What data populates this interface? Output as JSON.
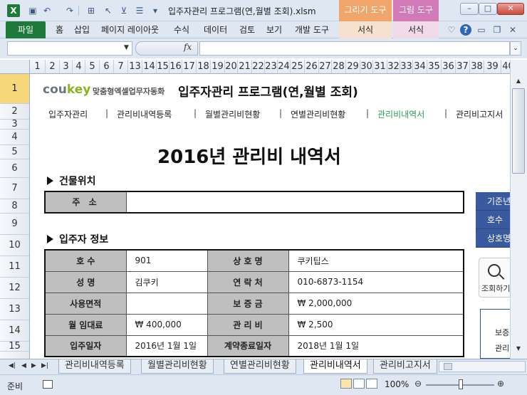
{
  "window": {
    "title": "입주자관리 프로그램(연,월별 조회).xlsm",
    "context_tabs": [
      "그리기 도구",
      "그림 도구"
    ],
    "buttons": {
      "minimize": "–",
      "maximize": "□",
      "close": "✕"
    }
  },
  "ribbon": {
    "file_tab": "파일",
    "tabs": [
      "홈",
      "삽입",
      "페이지 레이아웃",
      "수식",
      "데이터",
      "검토",
      "보기",
      "개발 도구"
    ],
    "context_subtabs": [
      "서식",
      "서식"
    ]
  },
  "formula_bar": {
    "name_box": "",
    "fx": "fx",
    "formula": ""
  },
  "column_headers": [
    "1",
    "2",
    "3",
    "4",
    "5",
    "6",
    "7",
    "13",
    "14",
    "15",
    "16",
    "17",
    "18",
    "19",
    "20",
    "21",
    "22",
    "23",
    "24",
    "25",
    "26",
    "27",
    "28",
    "29",
    "30",
    "31",
    "32",
    "33",
    "34",
    "35",
    "36",
    "37",
    "38",
    "39",
    "40"
  ],
  "row_headers": [
    "1",
    "2",
    "3",
    "4",
    "5",
    "6",
    "7",
    "8",
    "9",
    "10",
    "11",
    "12",
    "13",
    "14",
    "15"
  ],
  "sheet": {
    "brand": {
      "logo_main": "cou",
      "logo_key": "key",
      "subtitle": "맞춤형엑셀업무자동화"
    },
    "app_title": "입주자관리 프로그램(연,월별 조회)",
    "nav": [
      "입주자관리",
      "관리비내역등록",
      "월별관리비현황",
      "연별관리비현황",
      "관리비내역서",
      "관리비고지서"
    ],
    "nav_separator": "|",
    "report_title": "2016년 관리비 내역서",
    "building_section": {
      "heading": "건물위치",
      "address_label": "주 소",
      "address_value": ""
    },
    "tenant_section": {
      "heading": "입주자 정보",
      "rows": [
        {
          "l1": "호 수",
          "v1": "901",
          "l2": "상 호 명",
          "v2": "쿠키팁스"
        },
        {
          "l1": "성 명",
          "v1": "김쿠키",
          "l2": "연 락 처",
          "v2": "010-6873-1154"
        },
        {
          "l1": "사용면적",
          "v1": "",
          "l2": "보 증 금",
          "v2": "₩ 2,000,000"
        },
        {
          "l1": "월 임대료",
          "v1": "₩ 400,000",
          "l2": "관 리 비",
          "v2": "₩ 2,500"
        },
        {
          "l1": "입주일자",
          "v1": "2016년 1월 1일",
          "l2": "계약종료일자",
          "v2": "2018년 1월 1일"
        }
      ]
    },
    "side_panel": {
      "buttons": [
        "기준년",
        "호수",
        "상호명"
      ],
      "search_label": "조회하기",
      "box_lines": [
        "보증",
        "관리"
      ]
    }
  },
  "sheet_tabs": [
    "관리비내역등록",
    "월별관리비현황",
    "연별관리비현황",
    "관리비내역서",
    "관리비고지서"
  ],
  "sheet_tabs_active": 3,
  "status": {
    "ready": "준비",
    "zoom": "100%"
  }
}
